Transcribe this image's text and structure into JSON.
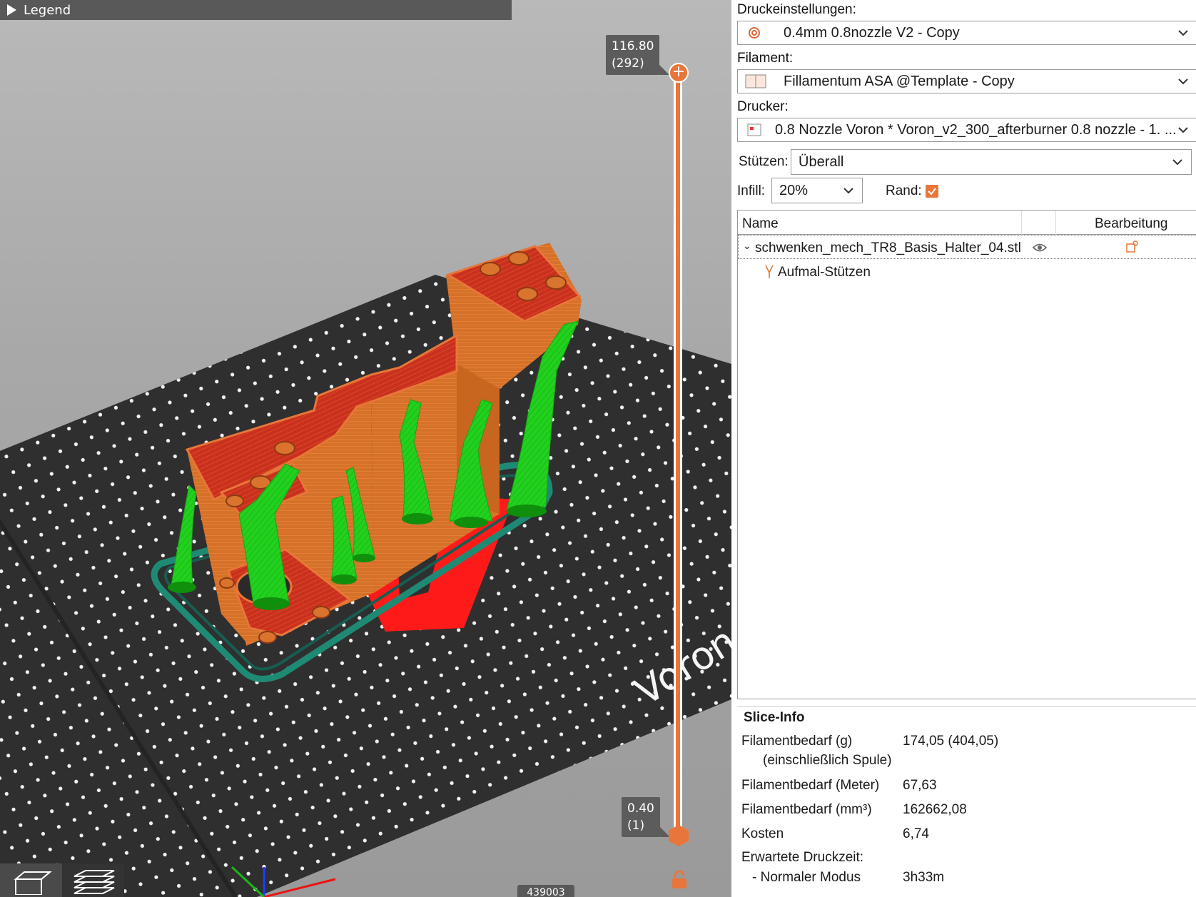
{
  "viewport": {
    "legend_label": "Legend",
    "layer_top_height": "116.80",
    "layer_top_index": "(292)",
    "layer_bottom_height": "0.40",
    "layer_bottom_index": "(1)",
    "bed_text": "Voron",
    "counter": "439003"
  },
  "sidebar": {
    "print_settings_label": "Druckeinstellungen:",
    "print_settings_value": "0.4mm 0.8nozzle V2 - Copy",
    "filament_label": "Filament:",
    "filament_value": "Fillamentum ASA @Template - Copy",
    "printer_label": "Drucker:",
    "printer_value": "0.8 Nozzle Voron  * Voron_v2_300_afterburner 0.8 nozzle - 1. ...",
    "supports_label": "Stützen:",
    "supports_value": "Überall",
    "infill_label": "Infill:",
    "infill_value": "20%",
    "brim_label": "Rand:",
    "brim_checked": true,
    "object_list": {
      "col_name": "Name",
      "col_edit": "Bearbeitung",
      "object_name": "schwenken_mech_TR8_Basis_Halter_04.stl",
      "child_name": "Aufmal-Stützen"
    },
    "slice_info": {
      "title": "Slice-Info",
      "rows": [
        {
          "label": "Filamentbedarf (g)",
          "value": "174,05 (404,05)"
        },
        {
          "label": "(einschließlich Spule)",
          "value": ""
        },
        {
          "label": "Filamentbedarf (Meter)",
          "value": "67,63"
        },
        {
          "label": "Filamentbedarf (mm³)",
          "value": "162662,08"
        },
        {
          "label": "Kosten",
          "value": "6,74"
        },
        {
          "label": "Erwartete Druckzeit:",
          "value": ""
        },
        {
          "label": "- Normaler Modus",
          "value": "3h33m"
        }
      ]
    }
  },
  "colors": {
    "accent": "#e8763a",
    "model_orange": "#d9742e",
    "model_red": "#c4251c",
    "support_green": "#22d11e",
    "bed": "#2e2e2e",
    "skirt": "#1f8a74"
  }
}
